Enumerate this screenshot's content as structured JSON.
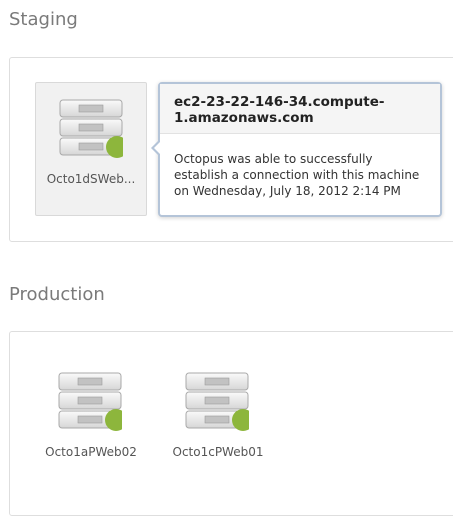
{
  "environments": [
    {
      "name": "Staging",
      "machines": [
        {
          "label": "Octo1dSWeb...",
          "status": "online",
          "selected": true
        }
      ]
    },
    {
      "name": "Production",
      "machines": [
        {
          "label": "Octo1aPWeb02",
          "status": "online"
        },
        {
          "label": "Octo1cPWeb01",
          "status": "online"
        }
      ]
    }
  ],
  "popover": {
    "hostname": "ec2-23-22-146-34.compute-1.amazonaws.com",
    "message": "Octopus was able to successfully establish a connection with this machine on Wednesday, July 18, 2012 2:14 PM"
  },
  "colors": {
    "status_online": "#8db63c",
    "popover_border": "#b4c4d8",
    "heading": "#7a7a7a"
  },
  "icons": {
    "machine": "server-icon",
    "status": "status-dot-icon"
  }
}
